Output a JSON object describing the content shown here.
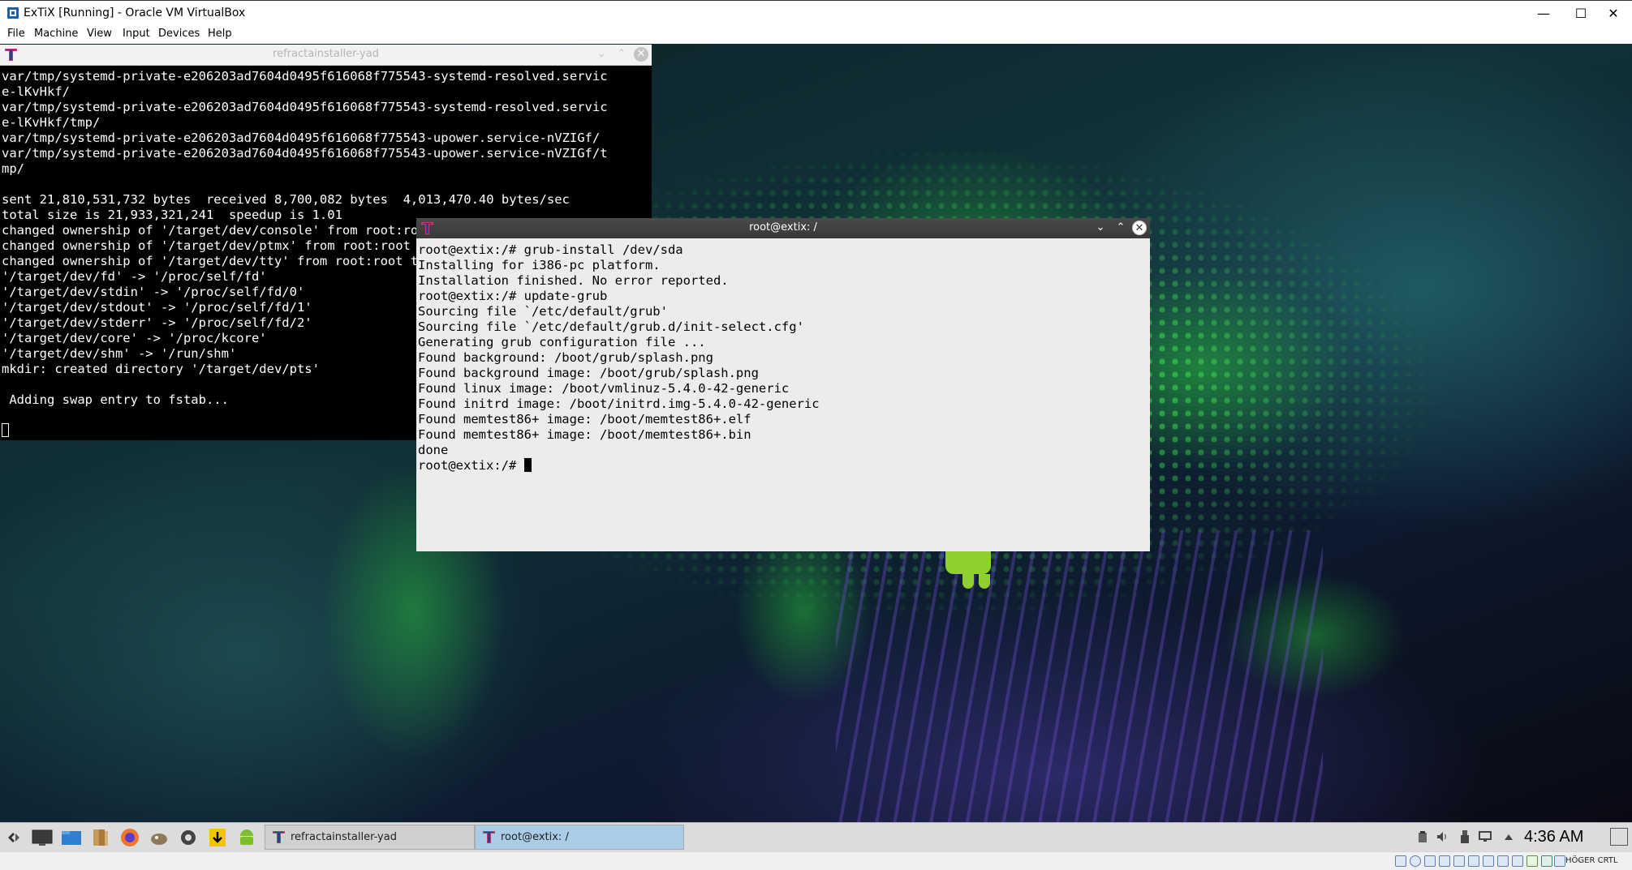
{
  "host": {
    "window_title": "ExTiX [Running] - Oracle VM VirtualBox",
    "controls": {
      "minimize": "—",
      "maximize": "☐",
      "close": "✕"
    },
    "menu": [
      "File",
      "Machine",
      "View",
      "Input",
      "Devices",
      "Help"
    ],
    "status_host_key": "HÖGER CRTL"
  },
  "terminal_background": {
    "title": "refractainstaller-yad",
    "controls": {
      "collapse": "⌄",
      "expand": "⌃",
      "close": "✕"
    },
    "lines": [
      "var/tmp/systemd-private-e206203ad7604d0495f616068f775543-systemd-resolved.servic",
      "e-lKvHkf/",
      "var/tmp/systemd-private-e206203ad7604d0495f616068f775543-systemd-resolved.servic",
      "e-lKvHkf/tmp/",
      "var/tmp/systemd-private-e206203ad7604d0495f616068f775543-upower.service-nVZIGf/",
      "var/tmp/systemd-private-e206203ad7604d0495f616068f775543-upower.service-nVZIGf/t",
      "mp/",
      "",
      "sent 21,810,531,732 bytes  received 8,700,082 bytes  4,013,470.40 bytes/sec",
      "total size is 21,933,321,241  speedup is 1.01",
      "changed ownership of '/target/dev/console' from root:root to root:tty",
      "changed ownership of '/target/dev/ptmx' from root:root to root:tty",
      "changed ownership of '/target/dev/tty' from root:root to root:tty",
      "'/target/dev/fd' -> '/proc/self/fd'",
      "'/target/dev/stdin' -> '/proc/self/fd/0'",
      "'/target/dev/stdout' -> '/proc/self/fd/1'",
      "'/target/dev/stderr' -> '/proc/self/fd/2'",
      "'/target/dev/core' -> '/proc/kcore'",
      "'/target/dev/shm' -> '/run/shm'",
      "mkdir: created directory '/target/dev/pts'",
      "",
      " Adding swap entry to fstab...",
      ""
    ]
  },
  "terminal_front": {
    "title": "root@extix: /",
    "controls": {
      "collapse": "⌄",
      "expand": "⌃",
      "close": "✕"
    },
    "lines": [
      "root@extix:/# grub-install /dev/sda",
      "Installing for i386-pc platform.",
      "Installation finished. No error reported.",
      "root@extix:/# update-grub",
      "Sourcing file `/etc/default/grub'",
      "Sourcing file `/etc/default/grub.d/init-select.cfg'",
      "Generating grub configuration file ...",
      "Found background: /boot/grub/splash.png",
      "Found background image: /boot/grub/splash.png",
      "Found linux image: /boot/vmlinuz-5.4.0-42-generic",
      "Found initrd image: /boot/initrd.img-5.4.0-42-generic",
      "Found memtest86+ image: /boot/memtest86+.elf",
      "Found memtest86+ image: /boot/memtest86+.bin",
      "done"
    ],
    "prompt": "root@extix:/# "
  },
  "taskbar": {
    "launchers": [
      "menu-icon",
      "terminal-icon",
      "file-manager-icon",
      "archive-icon",
      "firefox-icon",
      "gimp-icon",
      "settings-icon",
      "installer-icon",
      "android-icon"
    ],
    "tasks": [
      {
        "label": "refractainstaller-yad",
        "active": false
      },
      {
        "label": "root@extix: /",
        "active": true
      }
    ],
    "clock": "4:36 AM",
    "tray_icons": [
      "clipboard-icon",
      "volume-icon",
      "usb-icon",
      "display-icon",
      "tray-arrow-icon"
    ]
  },
  "colors": {
    "terminal_bg_dark": "#000000",
    "terminal_bg_light": "#ececec",
    "active_task": "#a9cde6",
    "titlebar_dark": "#3c3c3c",
    "glow_green": "#3ef04f"
  }
}
